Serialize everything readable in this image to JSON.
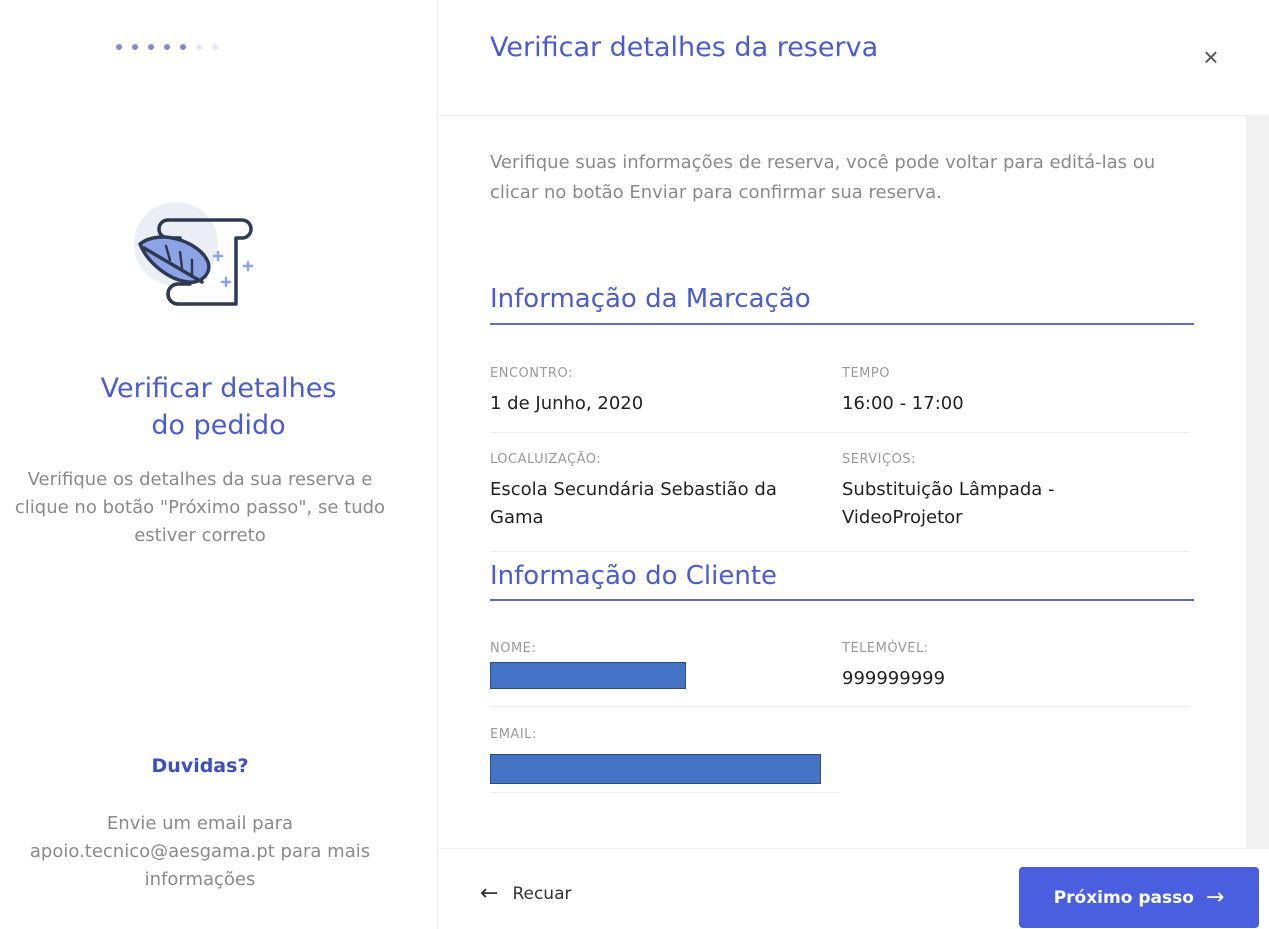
{
  "sidebar": {
    "steps_total": 7,
    "steps_completed": 5,
    "title": "Verificar detalhes do pedido",
    "description": "Verifique os detalhes da sua reserva e clique no botão \"Próximo passo\", se tudo estiver correto",
    "help_title": "Duvidas?",
    "help_text": "Envie um email para apoio.tecnico@aesgama.pt para mais informações",
    "icon": "scroll-quill-icon"
  },
  "header": {
    "title": "Verificar detalhes da reserva",
    "close_label": "×",
    "close_icon": "close-icon"
  },
  "main": {
    "intro": "Verifique suas informações de reserva, você pode voltar para editá-las ou clicar no botão Enviar para confirmar sua reserva.",
    "booking_section": {
      "title": "Informação da Marcação",
      "fields": {
        "meeting_label": "ENCONTRO:",
        "meeting_value": "1 de Junho, 2020",
        "time_label": "TEMPO",
        "time_value": "16:00 - 17:00",
        "location_label": "LOCALUIZAÇÃO:",
        "location_value": "Escola Secundária Sebastião da Gama",
        "services_label": "SERVIÇOS:",
        "services_value": "Substituição Lâmpada - VideoProjetor"
      }
    },
    "client_section": {
      "title": "Informação do Cliente",
      "fields": {
        "name_label": "NOME:",
        "phone_label": "TELEMÓVEL:",
        "phone_value": "999999999",
        "email_label": "EMAIL:"
      }
    }
  },
  "footer": {
    "back_label": "Recuar",
    "back_arrow": "←",
    "next_label": "Próximo passo",
    "next_arrow": "→"
  },
  "colors": {
    "accent": "#4a5bd4",
    "button": "#4a5fe0",
    "redaction": "#4472c4"
  }
}
